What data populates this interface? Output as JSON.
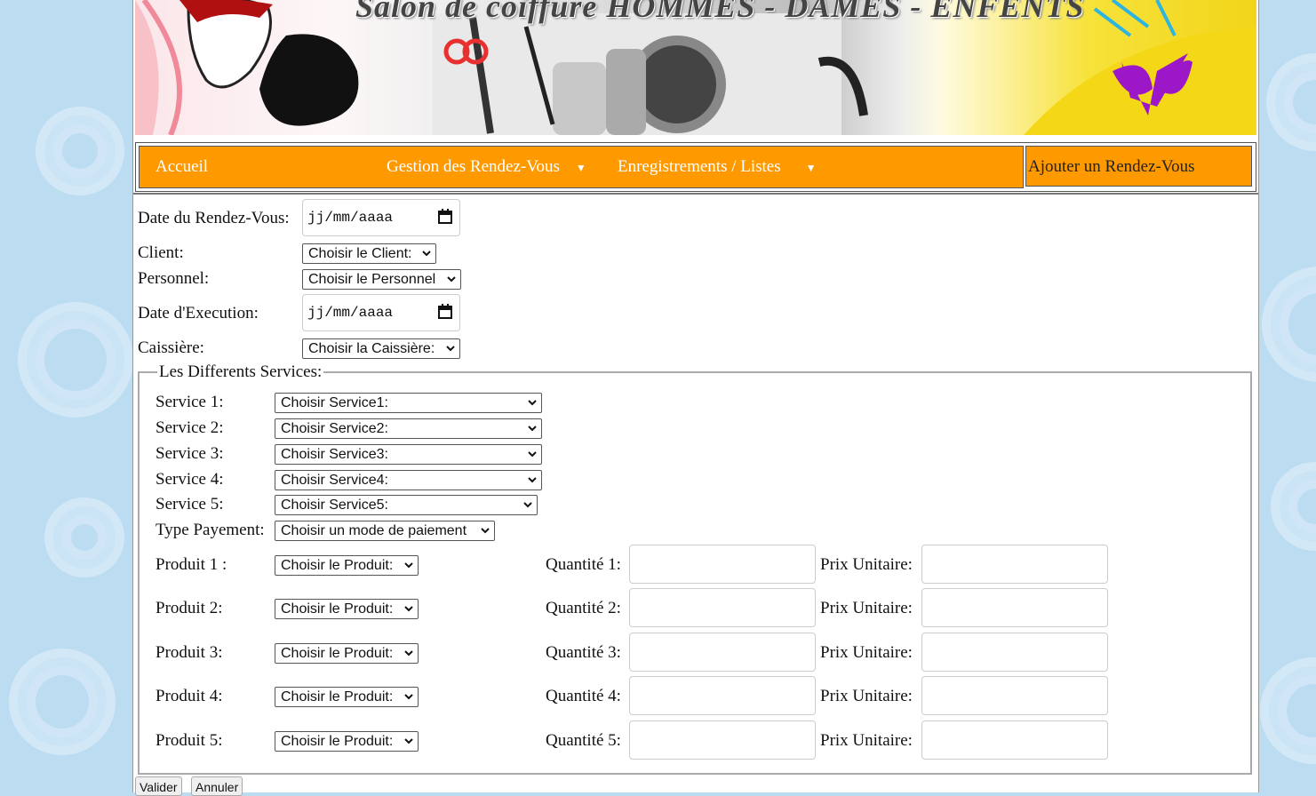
{
  "banner": {
    "title": "Salon de coiffure HOMMES - DAMES - ENFENTS"
  },
  "nav": {
    "items": [
      {
        "label": "Accueil"
      },
      {
        "label": "Gestion des Rendez-Vous"
      },
      {
        "label": "Enregistrements / Listes"
      }
    ],
    "right_label": "Ajouter un Rendez-Vous"
  },
  "form": {
    "date_rdv": {
      "label": "Date du Rendez-Vous:",
      "value": "jj/mm/aaaa"
    },
    "client": {
      "label": "Client:",
      "value": "Choisir le Client:"
    },
    "personnel": {
      "label": "Personnel:",
      "value": "Choisir le Personnel"
    },
    "date_exec": {
      "label": "Date d'Execution:",
      "value": "jj/mm/aaaa"
    },
    "caissiere": {
      "label": "Caissière:",
      "value": "Choisir la Caissière:"
    },
    "services_legend": "Les Differents Services:",
    "services": [
      {
        "label": "Service 1:",
        "value": "Choisir Service1:"
      },
      {
        "label": "Service 2:",
        "value": "Choisir Service2:"
      },
      {
        "label": "Service 3:",
        "value": "Choisir Service3:"
      },
      {
        "label": "Service 4:",
        "value": "Choisir Service4:"
      },
      {
        "label": "Service 5:",
        "value": "Choisir Service5:"
      }
    ],
    "payment": {
      "label": "Type Payement:",
      "value": "Choisir un mode de paiement"
    },
    "products": [
      {
        "label": "Produit 1 :",
        "value": "Choisir le Produit:",
        "qty_label": "Quantité 1:",
        "price_label": "Prix Unitaire:"
      },
      {
        "label": "Produit 2:",
        "value": "Choisir le Produit:",
        "qty_label": "Quantité 2:",
        "price_label": "Prix Unitaire:"
      },
      {
        "label": "Produit 3:",
        "value": "Choisir le Produit:",
        "qty_label": "Quantité 3:",
        "price_label": "Prix Unitaire:"
      },
      {
        "label": "Produit 4:",
        "value": "Choisir le Produit:",
        "qty_label": "Quantité 4:",
        "price_label": "Prix Unitaire:"
      },
      {
        "label": "Produit 5:",
        "value": "Choisir le Produit:",
        "qty_label": "Quantité 5:",
        "price_label": "Prix Unitaire:"
      }
    ],
    "buttons": {
      "validate": "Valider",
      "cancel": "Annuler"
    }
  },
  "colors": {
    "nav_bg": "#ff9900",
    "page_bg": "#bcdcf2"
  }
}
